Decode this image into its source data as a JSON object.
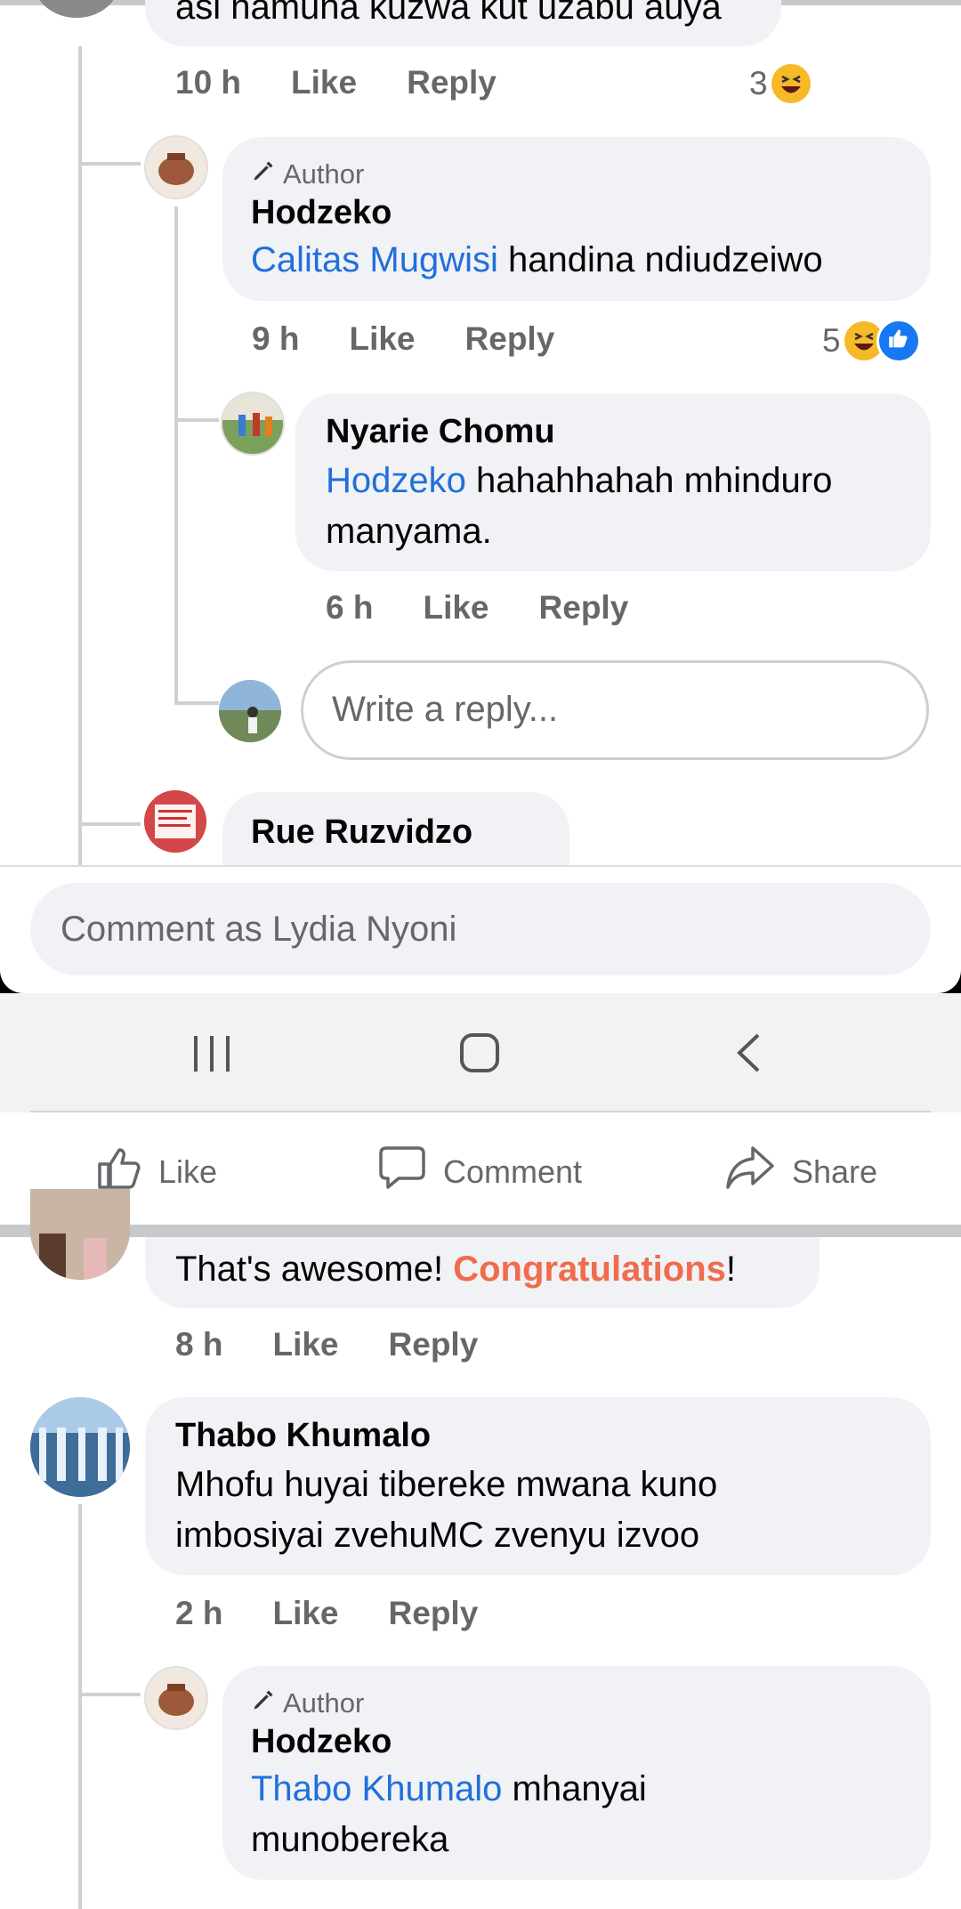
{
  "thread1": {
    "top_comment_text": "asi namuna kuzwa kut uzabu auya",
    "top_comment_meta": {
      "time": "10 h",
      "like": "Like",
      "reply": "Reply",
      "reaction_count": "3"
    },
    "reply1": {
      "author_badge": "Author",
      "name": "Hodzeko",
      "mention": "Calitas Mugwisi",
      "text": " handina ndiudzeiwo",
      "meta": {
        "time": "9 h",
        "like": "Like",
        "reply": "Reply",
        "reaction_count": "5"
      }
    },
    "reply2": {
      "name": "Nyarie Chomu",
      "mention": "Hodzeko",
      "text_line1": " hahahhahah mhinduro",
      "text_line2": "manyama.",
      "meta": {
        "time": "6 h",
        "like": "Like",
        "reply": "Reply"
      }
    },
    "reply_input": {
      "placeholder": "Write a reply..."
    },
    "reply3": {
      "name": "Rue Ruzvidzo"
    }
  },
  "comment_bar": {
    "placeholder": "Comment as Lydia Nyoni"
  },
  "actions": {
    "like": "Like",
    "comment": "Comment",
    "share": "Share"
  },
  "thread2": {
    "comment1": {
      "text_plain": "That's awesome! ",
      "text_highlight": "Congratulations",
      "text_end": "!",
      "meta": {
        "time": "8 h",
        "like": "Like",
        "reply": "Reply"
      }
    },
    "comment2": {
      "name": "Thabo Khumalo",
      "text_line1": "Mhofu huyai tibereke mwana kuno",
      "text_line2": "imbosiyai zvehuMC zvenyu izvoo",
      "meta": {
        "time": "2 h",
        "like": "Like",
        "reply": "Reply"
      }
    },
    "reply1": {
      "author_badge": "Author",
      "name": "Hodzeko",
      "mention": "Thabo Khumalo",
      "text_line1": " mhanyai",
      "text_line2": "munobereka"
    }
  },
  "colors": {
    "mention": "#216fdb",
    "highlight": "#f06c4d",
    "bubble": "#f0f2f5",
    "meta": "#65676b"
  }
}
